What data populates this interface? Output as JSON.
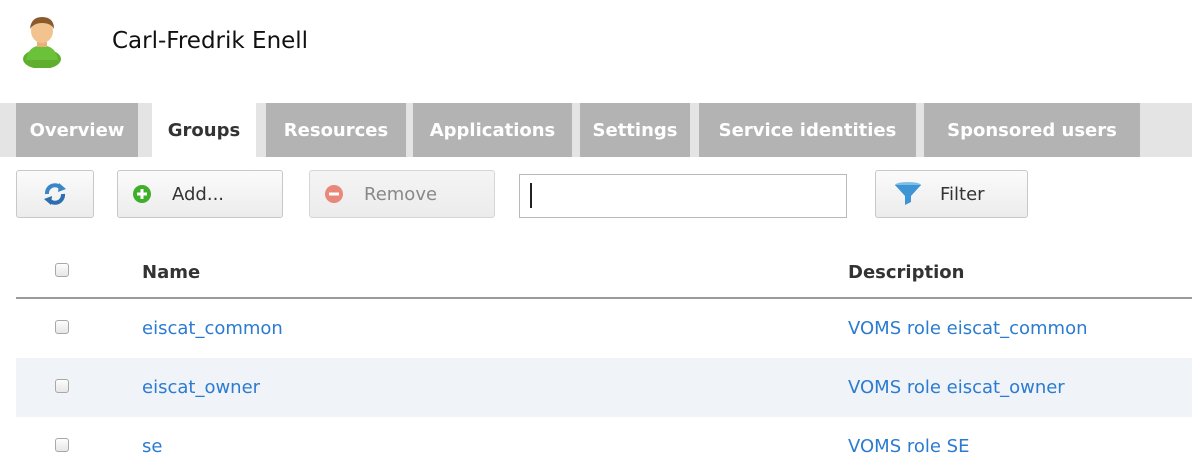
{
  "header": {
    "user_name": "Carl-Fredrik Enell",
    "avatar_icon": "user-avatar-icon"
  },
  "tabs": [
    {
      "label": "Overview",
      "active": false
    },
    {
      "label": "Groups",
      "active": true
    },
    {
      "label": "Resources",
      "active": false
    },
    {
      "label": "Applications",
      "active": false
    },
    {
      "label": "Settings",
      "active": false
    },
    {
      "label": "Service identities",
      "active": false
    },
    {
      "label": "Sponsored users",
      "active": false
    }
  ],
  "toolbar": {
    "refresh_icon": "refresh-icon",
    "add_label": "Add...",
    "add_icon": "plus-icon",
    "remove_label": "Remove",
    "remove_icon": "minus-icon",
    "search_value": "",
    "filter_label": "Filter",
    "filter_icon": "funnel-icon"
  },
  "table": {
    "columns": [
      "Name",
      "Description"
    ],
    "rows": [
      {
        "name": "eiscat_common",
        "description": "VOMS role eiscat_common"
      },
      {
        "name": "eiscat_owner",
        "description": "VOMS role eiscat_owner"
      },
      {
        "name": "se",
        "description": "VOMS role SE"
      }
    ]
  },
  "colors": {
    "link": "#2b7bd1",
    "tab_inactive": "#b3b3b3",
    "tab_bar": "#e4e4e4",
    "row_alt": "#f0f3f8"
  }
}
